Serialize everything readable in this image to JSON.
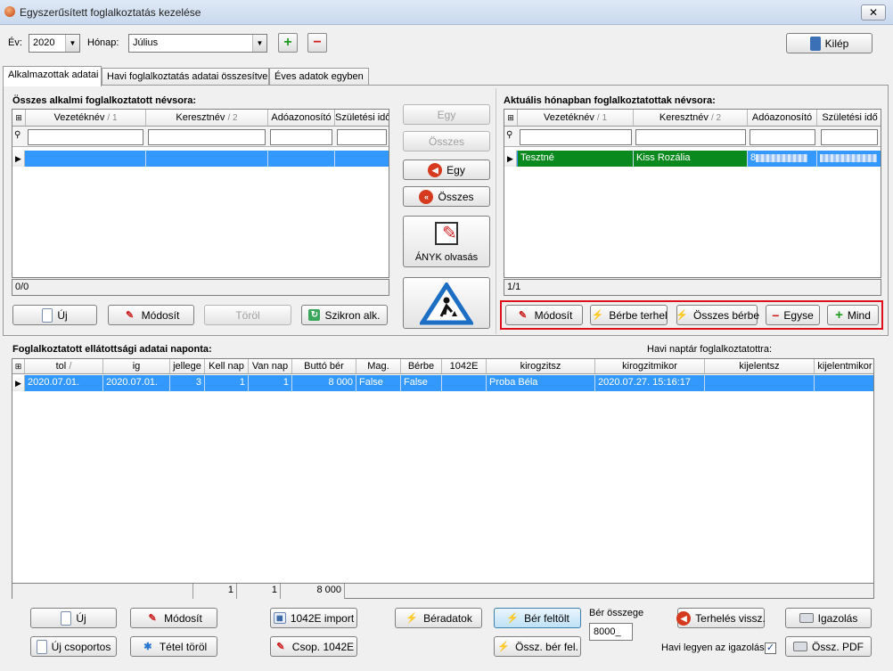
{
  "window": {
    "title": "Egyszerűsített foglalkoztatás kezelése",
    "close_glyph": "✕"
  },
  "toolbar": {
    "year_label": "Év:",
    "year_value": "2020",
    "month_label": "Hónap:",
    "month_value": "Július",
    "add_glyph": "+",
    "remove_glyph": "−",
    "exit_label": "Kilép"
  },
  "tabs": [
    {
      "label": "Alkalmazottak adatai"
    },
    {
      "label": "Havi foglalkoztatás adatai összesítve"
    },
    {
      "label": "Éves adatok egyben"
    }
  ],
  "left_panel": {
    "title": "Összes alkalmi foglalkoztatott névsora:",
    "columns": [
      {
        "label": "Vezetéknév",
        "sort": "/ 1"
      },
      {
        "label": "Keresztnév",
        "sort": "/ 2"
      },
      {
        "label": "Adóazonosító",
        "sort": ""
      },
      {
        "label": "Születési idő",
        "sort": ""
      }
    ],
    "status": "0/0",
    "buttons": {
      "new": "Új",
      "edit": "Módosít",
      "delete": "Töröl",
      "sync": "Szikron alk."
    }
  },
  "middle_panel": {
    "one_right": "Egy",
    "all_right": "Összes",
    "one_left": "Egy",
    "all_left": "Összes",
    "anyk": "ÁNYK olvasás"
  },
  "right_panel": {
    "title": "Aktuális hónapban foglalkoztatottak névsora:",
    "columns": [
      {
        "label": "Vezetéknév",
        "sort": "/ 1"
      },
      {
        "label": "Keresztnév",
        "sort": "/ 2"
      },
      {
        "label": "Adóazonosító",
        "sort": ""
      },
      {
        "label": "Születési idő",
        "sort": ""
      }
    ],
    "rows": [
      {
        "vezeteknev": "Tesztné",
        "keresztnev": "Kiss Rozália",
        "adoazonosito": "8",
        "szuletesi_ido": ""
      }
    ],
    "status": "1/1",
    "buttons": {
      "edit": "Módosít",
      "rent_charge": "Bérbe terhel",
      "all_rent": "Összes bérbe",
      "one_minus": "Egyse",
      "all_plus": "Mind"
    }
  },
  "daily": {
    "title": "Foglalkoztatott ellátottsági adatai naponta:",
    "calendar_label": "Havi naptár foglalkoztatottra:",
    "columns": [
      "tol",
      "ig",
      "jellege",
      "Kell nap",
      "Van nap",
      "Buttó bér",
      "Mag.",
      "Bérbe",
      "1042E",
      "kirogzitsz",
      "kirogzitmikor",
      "kijelentsz",
      "kijelentmikor"
    ],
    "rows": [
      [
        "2020.07.01.",
        "2020.07.01.",
        "3",
        "1",
        "1",
        "8 000",
        "False",
        "False",
        "",
        "Proba Béla",
        "2020.07.27. 15:16:17",
        "",
        ""
      ]
    ],
    "sums": {
      "kell_nap": "1",
      "van_nap": "1",
      "brutto": "8 000"
    }
  },
  "bottom": {
    "new": "Új",
    "edit": "Módosít",
    "import": "1042E import",
    "rent_data": "Béradatok",
    "wage_upload": "Bér feltölt",
    "wage_total_label": "Bér összege",
    "wage_total_value": "8000_",
    "charge_back": "Terhelés vissz.",
    "certify": "Igazolás",
    "new_group": "Új csoportos",
    "delete_item": "Tétel töröl",
    "group_1042": "Csop. 1042E",
    "total_wage_upload": "Össz. bér fel.",
    "monthly_cert_label": "Havi legyen az igazolás",
    "monthly_cert_checked": "✓",
    "total_pdf": "Össz. PDF"
  },
  "colors": {
    "selection": "#3399ff",
    "green_row": "#0a8a1e",
    "highlight": "#e0101a"
  }
}
